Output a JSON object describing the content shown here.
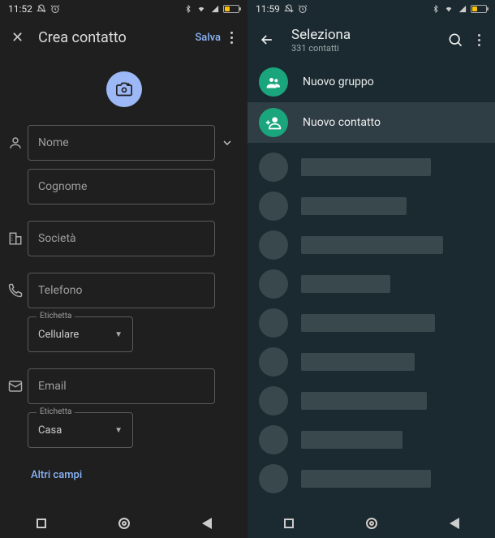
{
  "left": {
    "status": {
      "time": "11:52",
      "battery": "13"
    },
    "header": {
      "title": "Crea contatto",
      "save": "Salva"
    },
    "fields": {
      "name_ph": "Nome",
      "surname_ph": "Cognome",
      "company_ph": "Società",
      "phone_ph": "Telefono",
      "phone_label": "Etichetta",
      "phone_type": "Cellulare",
      "email_ph": "Email",
      "email_label": "Etichetta",
      "email_type": "Casa"
    },
    "more_fields": "Altri campi"
  },
  "right": {
    "status": {
      "time": "11:59",
      "battery": "13"
    },
    "header": {
      "title": "Seleziona",
      "subtitle": "331 contatti"
    },
    "actions": {
      "new_group": "Nuovo gruppo",
      "new_contact": "Nuovo contatto"
    },
    "placeholder_widths": [
      160,
      130,
      175,
      110,
      165,
      140,
      155,
      125,
      160
    ]
  }
}
